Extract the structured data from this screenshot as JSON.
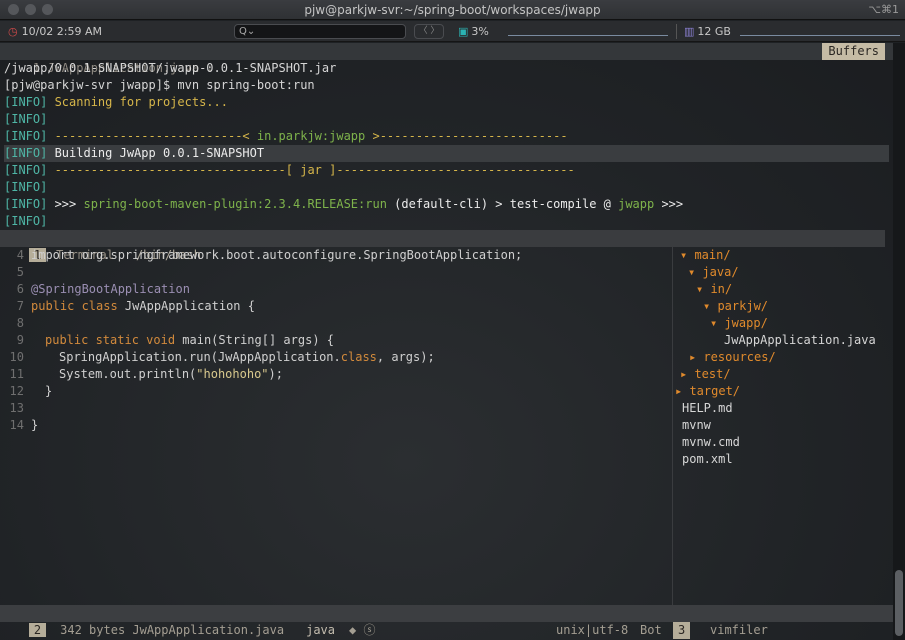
{
  "window": {
    "title": "pjw@parkjw-svr:~/spring-boot/workspaces/jwapp",
    "shortcut": "⌥⌘1"
  },
  "statusbar": {
    "clock_icon": "clock-icon",
    "clock": "10/02 2:59 AM",
    "search_placeholder": "Q",
    "nav": "〈 〉",
    "cpu_icon": "cpu-icon",
    "cpu": "3%",
    "mem_icon": "memory-icon",
    "mem": "12 GB"
  },
  "tabline": {
    "tab": "1 JwAppApplication.java ⇣",
    "buffers": "Buffers"
  },
  "terminal": {
    "lines": [
      "/jwapp/0.0.1-SNAPSHOT/jwapp-0.0.1-SNAPSHOT.jar",
      "[pjw@parkjw-svr jwapp]$ mvn spring-boot:run",
      "[INFO] Scanning for projects...",
      "[INFO]",
      "[INFO] --------------------------< ",
      "in.parkjw:jwapp",
      " >--------------------------",
      "[INFO] Building JwApp 0.0.1-SNAPSHOT",
      "[INFO] --------------------------------[ jar ]---------------------------------",
      "[INFO]",
      "[INFO] >>> ",
      "spring-boot-maven-plugin:2.3.4.RELEASE:run",
      " (default-cli) > test-compile @ ",
      "jwapp",
      " >>>",
      "[INFO]"
    ]
  },
  "midbar": {
    "num": "1",
    "label": "Terminal",
    "path": "/bin/bash"
  },
  "editor": {
    "line_numbers": [
      "4",
      "5",
      "6",
      "7",
      "8",
      "9",
      "10",
      "11",
      "12",
      "13",
      "14"
    ],
    "l4": "import org.springframework.boot.autoconfigure.SpringBootApplication;",
    "l6": "@SpringBootApplication",
    "l7_kw": "public class",
    "l7_rest": " JwAppApplication {",
    "l9_kw": "public static void",
    "l9_rest": " main(String[] args) {",
    "l10_a": "SpringApplication.run(JwAppApplication.",
    "l10_kw": "class",
    "l10_b": ", args);",
    "l11_a": "System.out.println(",
    "l11_str": "\"hohohoho\"",
    "l11_b": ");",
    "l12": "}",
    "l14": "}"
  },
  "filer": {
    "items": [
      "main/",
      "java/",
      "in/",
      "parkjw/",
      "jwapp/",
      "JwAppApplication.java",
      "resources/",
      "test/",
      "target/",
      "HELP.md",
      "mvnw",
      "mvnw.cmd",
      "pom.xml"
    ]
  },
  "statusline": {
    "num": "2",
    "file": "342 bytes JwAppApplication.java",
    "ft": "java",
    "marks": "◆ ⓢ",
    "enc": "unix|utf-8",
    "pos": "Bot",
    "num2": "3",
    "filer": "vimfiler"
  },
  "colors": {
    "background": "#1e2124",
    "keyword": "#d28a3c",
    "string": "#d9c98e",
    "info_cyan": "#4fb6a6",
    "info_yellow": "#d6b64a"
  }
}
